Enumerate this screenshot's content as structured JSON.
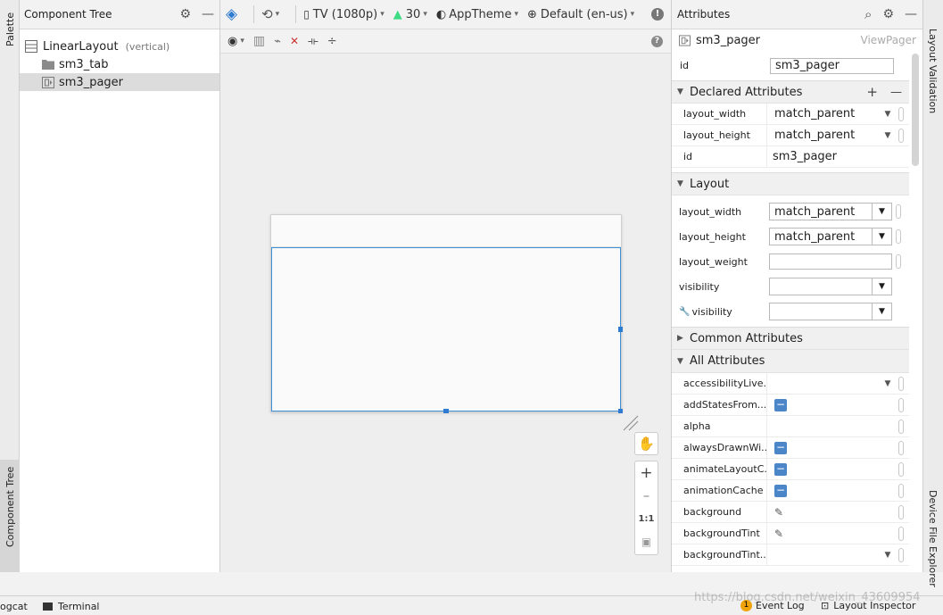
{
  "left_strip": {
    "palette": "Palette",
    "component_tree": "Component Tree"
  },
  "component_tree": {
    "title": "Component Tree",
    "items": [
      {
        "label": "LinearLayout",
        "hint": "(vertical)"
      },
      {
        "label": "sm3_tab"
      },
      {
        "label": "sm3_pager"
      }
    ]
  },
  "toolbar": {
    "device": "TV (1080p)",
    "api": "30",
    "theme": "AppTheme",
    "locale": "Default (en-us)"
  },
  "zoom": {
    "fit_label": "1:1"
  },
  "attributes": {
    "title": "Attributes",
    "component_name": "sm3_pager",
    "component_type": "ViewPager",
    "id_label": "id",
    "id_value": "sm3_pager",
    "declared": {
      "title": "Declared Attributes",
      "rows": [
        {
          "name": "layout_width",
          "value": "match_parent"
        },
        {
          "name": "layout_height",
          "value": "match_parent"
        },
        {
          "name": "id",
          "value": "sm3_pager"
        }
      ]
    },
    "layout": {
      "title": "Layout",
      "rows": [
        {
          "name": "layout_width",
          "value": "match_parent"
        },
        {
          "name": "layout_height",
          "value": "match_parent"
        },
        {
          "name": "layout_weight",
          "value": ""
        },
        {
          "name": "visibility",
          "value": ""
        },
        {
          "name": "visibility",
          "value": ""
        }
      ]
    },
    "common_title": "Common Attributes",
    "all": {
      "title": "All Attributes",
      "rows": [
        {
          "name": "accessibilityLive..."
        },
        {
          "name": "addStatesFrom..."
        },
        {
          "name": "alpha"
        },
        {
          "name": "alwaysDrawnWi..."
        },
        {
          "name": "animateLayoutC..."
        },
        {
          "name": "animationCache"
        },
        {
          "name": "background"
        },
        {
          "name": "backgroundTint"
        },
        {
          "name": "backgroundTint..."
        }
      ]
    }
  },
  "right_strip": {
    "layout_validation": "Layout Validation",
    "device_file_explorer": "Device File Explorer"
  },
  "bottom_bar": {
    "logcat": "ogcat",
    "terminal": "Terminal",
    "watermark": "https://blog.csdn.net/weixin_43609954",
    "event_log": "Event Log",
    "event_badge": "1",
    "layout_inspector": "Layout Inspector"
  }
}
